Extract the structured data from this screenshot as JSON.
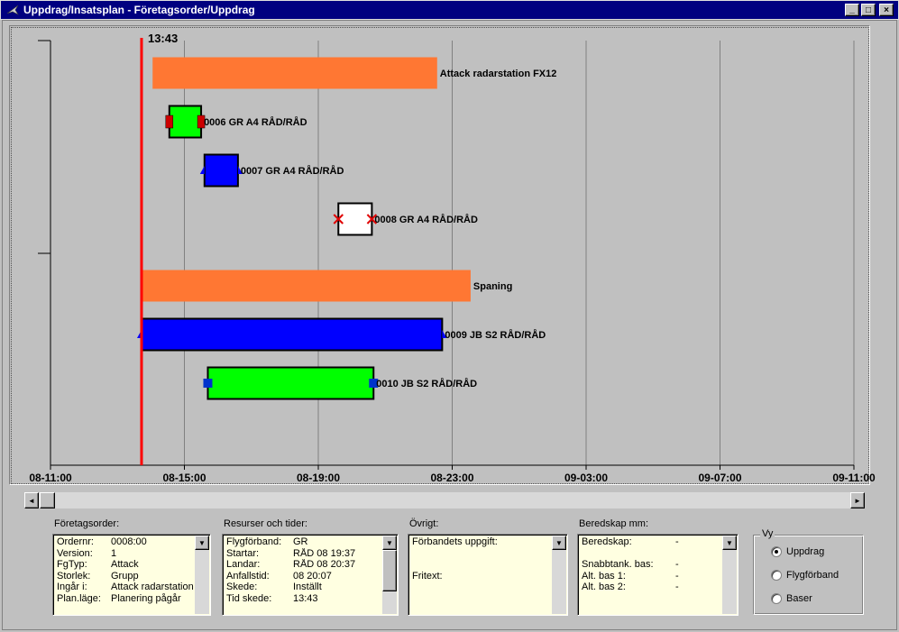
{
  "window": {
    "title": "Uppdrag/Insatsplan - Företagsorder/Uppdrag",
    "minimize_label": "_",
    "maximize_label": "□",
    "close_label": "×"
  },
  "timeline": {
    "current_time": "13:43",
    "current_time_hours": 2.72,
    "axis_ticks": [
      "08-11:00",
      "08-15:00",
      "08-19:00",
      "08-23:00",
      "09-03:00",
      "09-07:00",
      "09-11:00"
    ],
    "axis_start_hours": 0,
    "axis_end_hours": 24,
    "colors": {
      "now_line": "#ff0000",
      "attack": "#ff7733",
      "green": "#00ff00",
      "blue": "#0000ff",
      "white": "#ffffff",
      "marker_red": "#cc0000",
      "marker_blue": "#0033cc"
    },
    "bars": [
      {
        "label": "Attack radarstation FX12",
        "start": 3.05,
        "end": 11.55,
        "kind": "group",
        "color": "#ff7733",
        "markers": "none"
      },
      {
        "label": "0006 GR A4 RÅD/RÅD",
        "start": 3.55,
        "end": 4.5,
        "kind": "mission",
        "color": "#00ff00",
        "markers": "red-square"
      },
      {
        "label": "0007 GR A4 RÅD/RÅD",
        "start": 4.6,
        "end": 5.6,
        "kind": "mission",
        "color": "#0000ff",
        "markers": "blue-triangle"
      },
      {
        "label": "0008 GR A4 RÅD/RÅD",
        "start": 8.6,
        "end": 9.6,
        "kind": "mission",
        "color": "#ffffff",
        "markers": "red-x"
      },
      {
        "label": "Spaning",
        "start": 2.72,
        "end": 12.55,
        "kind": "group",
        "color": "#ff7733",
        "markers": "none"
      },
      {
        "label": "0009 JB S2 RÅD/RÅD",
        "start": 2.72,
        "end": 11.7,
        "kind": "mission",
        "color": "#0000ff",
        "markers": "blue-triangle"
      },
      {
        "label": "0010 JB S2 RÅD/RÅD",
        "start": 4.7,
        "end": 9.65,
        "kind": "mission",
        "color": "#00ff00",
        "markers": "blue-square"
      }
    ]
  },
  "panels": {
    "foretagsorder": {
      "title": "Företagsorder:",
      "rows": [
        {
          "k": "Ordernr:",
          "v": "0008:00"
        },
        {
          "k": "Version:",
          "v": "1"
        },
        {
          "k": "FgTyp:",
          "v": "Attack"
        },
        {
          "k": "Storlek:",
          "v": "Grupp"
        },
        {
          "k": "Ingår i:",
          "v": "Attack radarstation FX"
        },
        {
          "k": "Plan.läge:",
          "v": "Planering pågår"
        }
      ]
    },
    "resurser": {
      "title": "Resurser och tider:",
      "rows": [
        {
          "k": "Flygförband:",
          "v": "GR"
        },
        {
          "k": "Startar:",
          "v": "RÅD 08 19:37"
        },
        {
          "k": "Landar:",
          "v": "RÅD 08 20:37"
        },
        {
          "k": "Anfallstid:",
          "v": "08 20:07"
        },
        {
          "k": "Skede:",
          "v": "Inställt"
        },
        {
          "k": "Tid skede:",
          "v": "13:43"
        }
      ]
    },
    "ovrigt": {
      "title": "Övrigt:",
      "rows": [
        {
          "k": "Förbandets uppgift:",
          "v": ""
        },
        {
          "k": "",
          "v": ""
        },
        {
          "k": "",
          "v": ""
        },
        {
          "k": "Fritext:",
          "v": ""
        }
      ]
    },
    "beredskap": {
      "title": "Beredskap mm:",
      "rows": [
        {
          "k": "Beredskap:",
          "v": "-"
        },
        {
          "k": "",
          "v": ""
        },
        {
          "k": "Snabbtank. bas:",
          "v": "-"
        },
        {
          "k": "Alt. bas 1:",
          "v": "-"
        },
        {
          "k": "Alt. bas 2:",
          "v": "-"
        }
      ]
    }
  },
  "vy": {
    "title": "Vy",
    "options": [
      {
        "label": "Uppdrag",
        "selected": true
      },
      {
        "label": "Flygförband",
        "selected": false
      },
      {
        "label": "Baser",
        "selected": false
      }
    ]
  },
  "scrollbar": {
    "left_arrow": "◄",
    "right_arrow": "►",
    "up_arrow": "▲",
    "down_arrow": "▼"
  }
}
